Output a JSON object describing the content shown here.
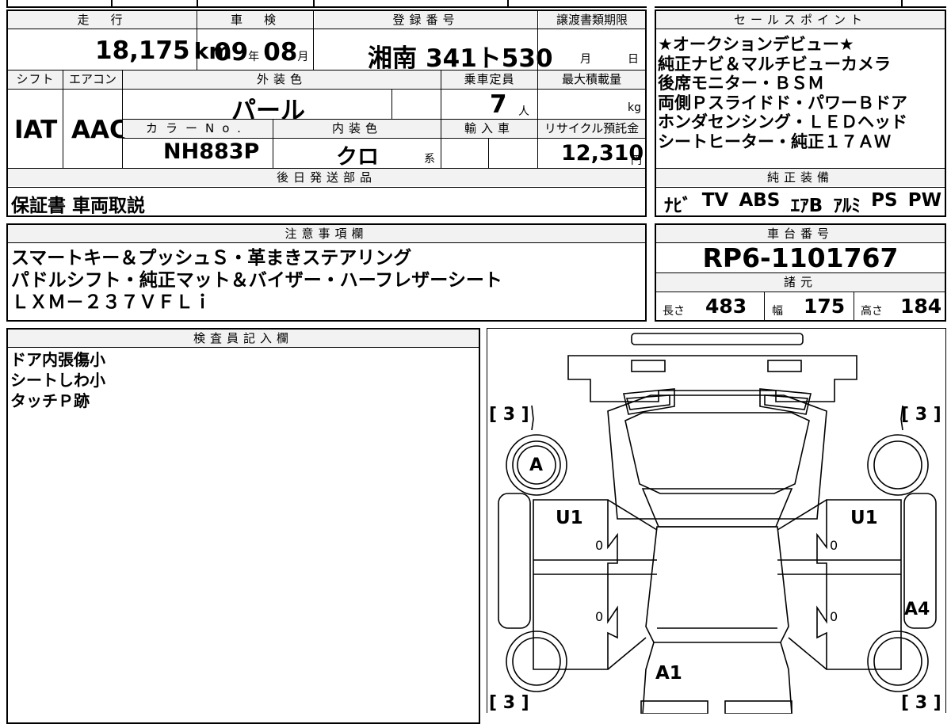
{
  "headers": {
    "mileage": "走　行",
    "inspection": "車　検",
    "registration": "登録番号",
    "transfer_deadline": "譲渡書類期限",
    "sales_points": "セールスポイント",
    "shift": "シフト",
    "aircon": "エアコン",
    "exterior_color": "外装色",
    "capacity": "乗車定員",
    "max_load": "最大積載量",
    "color_no": "カラーNo.",
    "interior_color": "内装色",
    "import": "輸入車",
    "recycle_fee": "リサイクル預託金",
    "later_parts": "後日発送部品",
    "genuine_equipment": "純正装備",
    "notes": "注意事項欄",
    "chassis_no": "車台番号",
    "specs": "諸元",
    "inspector": "検査員記入欄"
  },
  "vehicle": {
    "mileage": "18,175",
    "mileage_unit": "km",
    "inspection_year": "09",
    "year_unit": "年",
    "inspection_month": "08",
    "month_unit": "月",
    "registration_region": "湘南",
    "registration_number": "341ト530",
    "transfer_month_unit": "月",
    "transfer_day_unit": "日",
    "shift": "IAT",
    "aircon": "AAC",
    "exterior_color": "パール",
    "capacity": "7",
    "capacity_unit": "人",
    "max_load_unit": "kg",
    "color_no": "NH883P",
    "interior_color": "クロ",
    "interior_suffix": "系",
    "recycle_fee": "12,310",
    "recycle_unit": "円",
    "chassis_no": "RP6-1101767"
  },
  "sales_points": [
    "★オークションデビュー★",
    "純正ナビ＆マルチビューカメラ",
    "後席モニター・ＢＳＭ",
    "両側Ｐスライドド・パワーＢドア",
    "ホンダセンシング・ＬＥＤヘッド",
    "シートヒーター・純正１７ＡＷ"
  ],
  "later_parts": "保証書 車両取説",
  "equipment": [
    "ﾅﾋﾞ",
    "TV",
    "ABS",
    "ｴｱB",
    "ｱﾙﾐ",
    "PS",
    "PW"
  ],
  "notes": [
    "スマートキー＆プッシュＳ・革まきステアリング",
    "パドルシフト・純正マット＆バイザー・ハーフレザーシート",
    "ＬＸＭ－２３７ＶＦＬｉ"
  ],
  "specs": {
    "length_label": "長さ",
    "length": "483",
    "width_label": "幅",
    "width": "175",
    "height_label": "高さ",
    "height": "184"
  },
  "inspector_notes": [
    "ドア内張傷小",
    "シートしわ小",
    "タッチＰ跡"
  ],
  "diagram": {
    "tire_fl": "[ 3 ]",
    "tire_fr": "[ 3 ]",
    "tire_rl": "[ 3 ]",
    "tire_rr": "[ 3 ]",
    "mark_a": "A",
    "mark_u1_left": "U1",
    "mark_u1_right": "U1",
    "mark_a4": "A4",
    "mark_a1": "A1",
    "zero": "0"
  }
}
